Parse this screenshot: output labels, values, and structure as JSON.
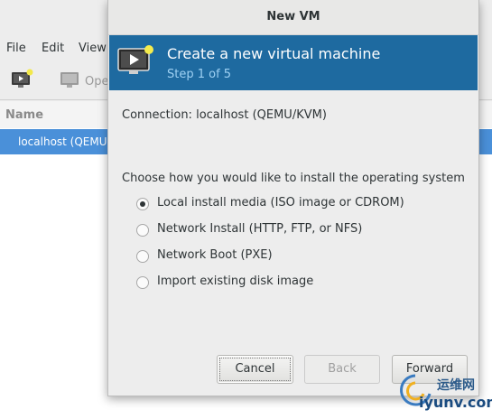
{
  "main_window": {
    "menu": [
      "File",
      "Edit",
      "View"
    ],
    "toolbar_open_label": "Ope",
    "list_header": "Name",
    "connection_row": "localhost (QEMU)"
  },
  "dialog": {
    "title": "New VM",
    "banner_title": "Create a new virtual machine",
    "banner_step": "Step 1 of 5",
    "connection_label": "Connection:",
    "connection_value": "localhost (QEMU/KVM)",
    "prompt": "Choose how you would like to install the operating system",
    "options": [
      {
        "label": "Local install media (ISO image or CDROM)",
        "checked": true
      },
      {
        "label": "Network Install (HTTP, FTP, or NFS)",
        "checked": false
      },
      {
        "label": "Network Boot (PXE)",
        "checked": false
      },
      {
        "label": "Import existing disk image",
        "checked": false
      }
    ],
    "buttons": {
      "cancel": "Cancel",
      "back": "Back",
      "forward": "Forward"
    }
  },
  "watermark": {
    "line1": "运维网",
    "line2": "iyunv.com"
  },
  "colors": {
    "banner": "#1e6aa0",
    "selection": "#4a90d9",
    "step_text": "#9fd1f3"
  },
  "icons": [
    "new-vm-icon",
    "monitor-icon",
    "banner-vm-icon"
  ]
}
